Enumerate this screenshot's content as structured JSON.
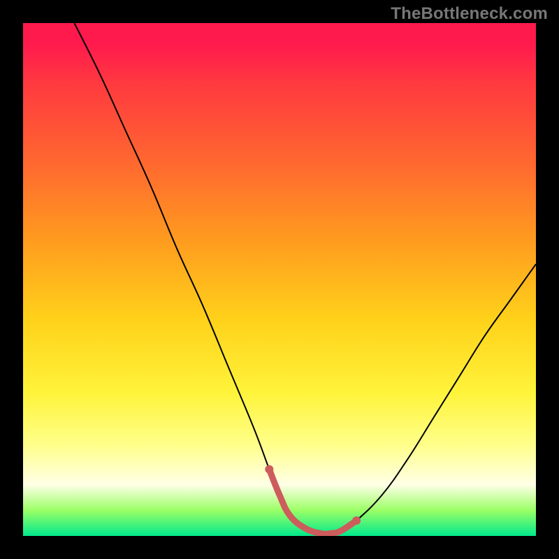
{
  "watermark": "TheBottleneck.com",
  "chart_data": {
    "type": "line",
    "title": "",
    "xlabel": "",
    "ylabel": "",
    "xlim": [
      0,
      100
    ],
    "ylim": [
      0,
      100
    ],
    "grid": false,
    "legend": false,
    "series": [
      {
        "name": "curve",
        "x": [
          10,
          15,
          20,
          25,
          30,
          35,
          40,
          45,
          48,
          50,
          52,
          55,
          58,
          60,
          62,
          65,
          70,
          75,
          80,
          85,
          90,
          95,
          100
        ],
        "y": [
          100,
          90,
          79,
          68,
          56,
          45,
          33,
          21,
          13,
          8,
          4,
          1.5,
          0.5,
          0.5,
          1,
          3,
          8,
          15,
          23,
          31,
          39,
          46,
          53
        ]
      }
    ],
    "highlight": {
      "x_range": [
        48,
        65
      ],
      "color": "#cd5c5c"
    },
    "background_gradient": {
      "direction": "vertical",
      "stops": [
        {
          "pos": 0.0,
          "color": "#ff1a4d"
        },
        {
          "pos": 0.5,
          "color": "#ffd21a"
        },
        {
          "pos": 0.9,
          "color": "#ffffe6"
        },
        {
          "pos": 1.0,
          "color": "#00e88c"
        }
      ]
    }
  }
}
